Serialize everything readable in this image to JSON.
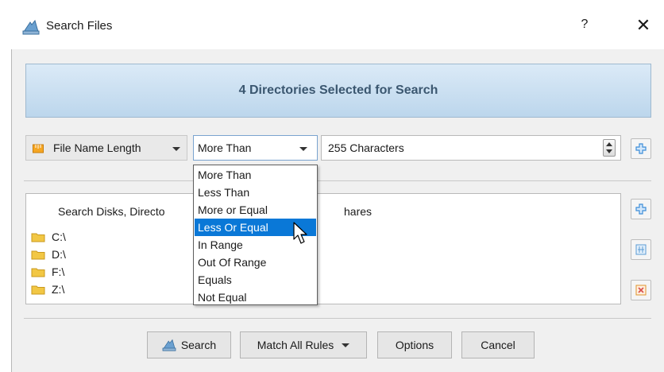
{
  "window": {
    "title": "Search Files",
    "help_label": "?",
    "close_label": "✕"
  },
  "banner": {
    "text": "4 Directories Selected for Search"
  },
  "rule": {
    "type_label": "File Name Length",
    "operator_selected": "More Than",
    "value_text": "255 Characters",
    "operator_options": [
      "More Than",
      "Less Than",
      "More or Equal",
      "Less Or Equal",
      "In Range",
      "Out Of Range",
      "Equals",
      "Not Equal"
    ],
    "highlighted_option": "Less Or Equal"
  },
  "directories": {
    "header_left": "Search Disks, Directo",
    "header_right": "hares",
    "items": [
      "C:\\",
      "D:\\",
      "F:\\",
      "Z:\\"
    ]
  },
  "footer": {
    "search_label": "Search",
    "match_label": "Match All Rules",
    "options_label": "Options",
    "cancel_label": "Cancel"
  },
  "colors": {
    "banner_text": "#3b5770",
    "selection": "#0a78d7",
    "folder": "#f2c744",
    "plus_icon": "#3e8ed8",
    "remove_icon": "#d9534f"
  },
  "icons": {
    "app": "disk-search-icon",
    "rule_type": "ruler-icon",
    "add": "plus-icon",
    "edit": "grid-icon",
    "remove": "remove-icon",
    "folder": "folder-icon",
    "cursor": "mouse-cursor-icon"
  }
}
